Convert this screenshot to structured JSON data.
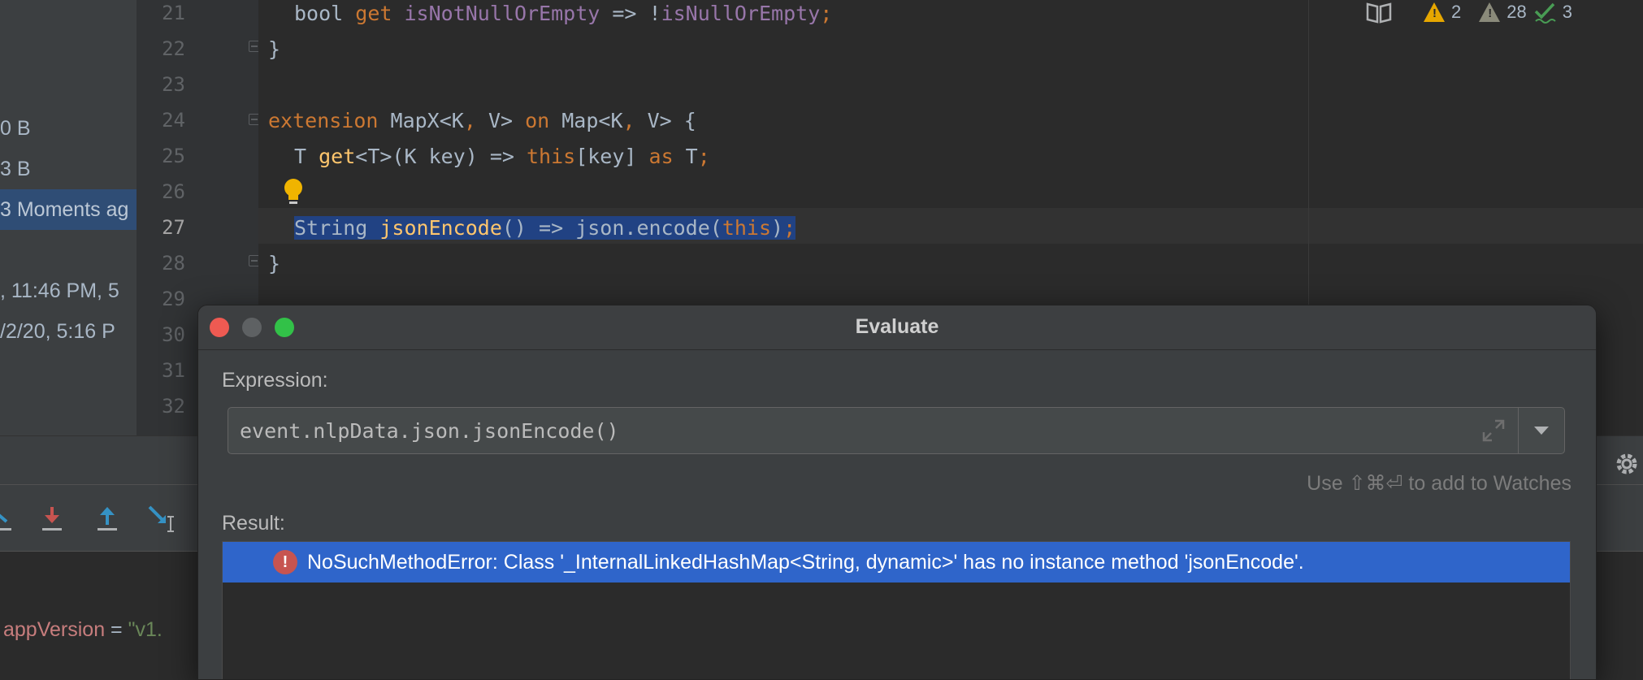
{
  "project_panel": {
    "rows": [
      "0 B",
      "3 B",
      "3 Moments ag",
      ", 11:46 PM, 5",
      "/2/20, 5:16 P"
    ]
  },
  "editor": {
    "line_numbers": [
      "21",
      "22",
      "23",
      "24",
      "25",
      "26",
      "27",
      "28",
      "29",
      "30",
      "31",
      "32"
    ],
    "inspections": {
      "warnings": "2",
      "weak_warnings": "28",
      "typos": "3"
    }
  },
  "debug": {
    "variable_name": "appVersion",
    "variable_eq": " = ",
    "variable_value": "\"v1."
  },
  "dialog": {
    "title": "Evaluate",
    "expression_label": "Expression:",
    "expression_value": "event.nlpData.json.jsonEncode()",
    "watches_hint": "Use ⇧⌘⏎ to add to Watches",
    "result_label": "Result:",
    "result_text": "NoSuchMethodError: Class '_InternalLinkedHashMap<String, dynamic>' has no instance method 'jsonEncode'."
  }
}
